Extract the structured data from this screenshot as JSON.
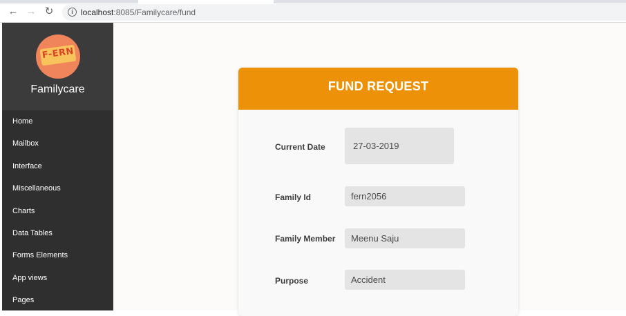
{
  "browser": {
    "back_icon": "arrow-left-icon",
    "forward_icon": "arrow-right-icon",
    "reload_icon": "reload-icon",
    "info_icon": "info-icon",
    "url_host": "localhost",
    "url_path": ":8085/Familycare/fund"
  },
  "sidebar": {
    "logo_text": "F-ERN",
    "brand": "Familycare",
    "items": [
      {
        "label": "Home"
      },
      {
        "label": "Mailbox"
      },
      {
        "label": "Interface"
      },
      {
        "label": "Miscellaneous"
      },
      {
        "label": "Charts"
      },
      {
        "label": "Data Tables"
      },
      {
        "label": "Forms Elements"
      },
      {
        "label": "App views"
      },
      {
        "label": "Pages"
      }
    ]
  },
  "form": {
    "title": "FUND REQUEST",
    "fields": [
      {
        "label": "Current Date",
        "value": "27-03-2019"
      },
      {
        "label": "Family Id",
        "value": "fern2056"
      },
      {
        "label": "Family Member",
        "value": "Meenu Saju"
      },
      {
        "label": "Purpose",
        "value": "Accident"
      }
    ]
  },
  "colors": {
    "sidebar_bg": "#2f2f2f",
    "header_accent": "#ec9108",
    "logo_bg": "#f0845a"
  }
}
